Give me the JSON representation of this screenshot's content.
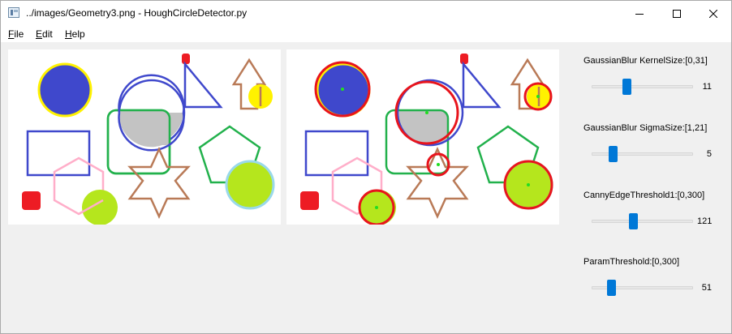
{
  "window": {
    "title": "../images/Geometry3.png - HoughCircleDetector.py"
  },
  "menu": {
    "file": {
      "mnemonic": "F",
      "rest": "ile"
    },
    "edit": {
      "mnemonic": "E",
      "rest": "dit"
    },
    "help": {
      "mnemonic": "H",
      "rest": "elp"
    }
  },
  "controls": [
    {
      "label": "GaussianBlur KernelSize:[0,31]",
      "value": "11",
      "position": 0.33
    },
    {
      "label": "GaussianBlur SigmaSize:[1,21]",
      "value": "5",
      "position": 0.18
    },
    {
      "label": "CannyEdgeThreshold1:[0,300]",
      "value": "121",
      "position": 0.4
    },
    {
      "label": "ParamThreshold:[0,300]",
      "value": "51",
      "position": 0.17
    }
  ],
  "colors": {
    "accent": "#0078d7",
    "circle_highlight": "#e8141c",
    "center_dot": "#22dd22"
  },
  "icons": {
    "minimize": "minimize-icon",
    "maximize": "maximize-icon",
    "close": "close-icon"
  }
}
